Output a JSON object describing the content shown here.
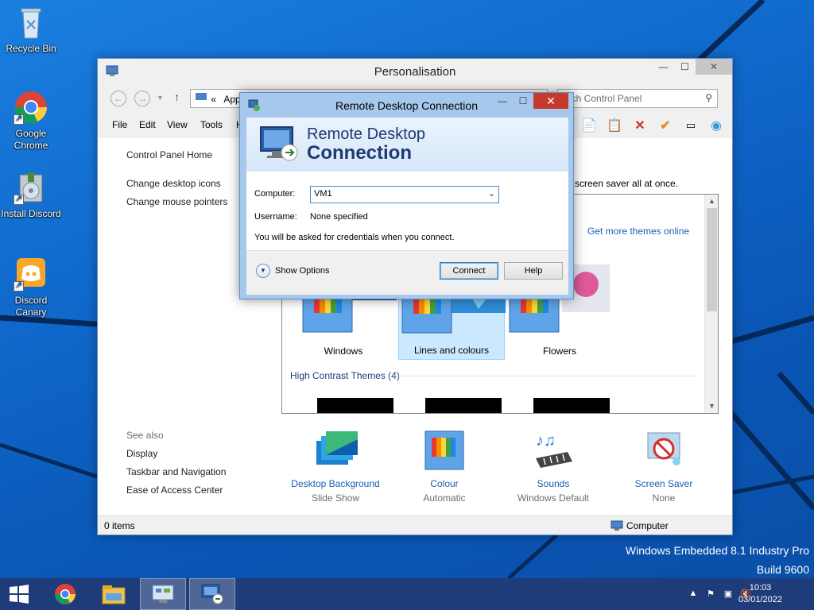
{
  "desktop": {
    "icons": [
      {
        "label": "Recycle Bin",
        "icon": "recycle-bin-icon"
      },
      {
        "label": "Google Chrome",
        "icon": "chrome-icon"
      },
      {
        "label": "Install Discord",
        "icon": "installer-icon"
      },
      {
        "label": "Discord Canary",
        "icon": "discord-icon"
      }
    ],
    "watermark_line1": "Windows Embedded 8.1 Industry Pro",
    "watermark_line2": "Build 9600"
  },
  "taskbar": {
    "start_icon": "windows-start-icon",
    "pinned": [
      {
        "icon": "chrome-icon"
      },
      {
        "icon": "file-explorer-icon"
      },
      {
        "icon": "control-panel-icon"
      },
      {
        "icon": "remote-desktop-icon"
      }
    ],
    "tray_icons": [
      "chevron-up-icon",
      "flag-icon",
      "network-icon",
      "speaker-muted-icon"
    ],
    "time": "10:03",
    "date": "03/01/2022"
  },
  "personalisation": {
    "title": "Personalisation",
    "address_chevron": "«",
    "address": "App",
    "search_placeholder": "Search Control Panel",
    "search_visible": "arch Control Panel",
    "menu": [
      "File",
      "Edit",
      "View",
      "Tools",
      "H"
    ],
    "left_nav": {
      "home": "Control Panel Home",
      "links": [
        "Change desktop icons",
        "Change mouse pointers"
      ]
    },
    "description_fragment": "screen saver all at once.",
    "get_more_themes": "Get more themes online",
    "themes": [
      {
        "label": "Windows",
        "selected": false
      },
      {
        "label": "Lines and colours",
        "selected": true
      },
      {
        "label": "Flowers",
        "selected": false
      }
    ],
    "high_contrast_heading": "High Contrast Themes (4)",
    "see_also": {
      "heading": "See also",
      "links": [
        "Display",
        "Taskbar and Navigation",
        "Ease of Access Center"
      ]
    },
    "bottom_items": [
      {
        "label": "Desktop Background",
        "sub": "Slide Show",
        "icon": "desktop-background-icon"
      },
      {
        "label": "Colour",
        "sub": "Automatic",
        "icon": "colour-icon"
      },
      {
        "label": "Sounds",
        "sub": "Windows Default",
        "icon": "sounds-icon"
      },
      {
        "label": "Screen Saver",
        "sub": "None",
        "icon": "screen-saver-icon"
      }
    ],
    "status_left": "0 items",
    "status_right": "Computer"
  },
  "rdc": {
    "title": "Remote Desktop Connection",
    "banner_line1": "Remote Desktop",
    "banner_line2": "Connection",
    "computer_label": "Computer:",
    "computer_value": "VM1",
    "username_label": "Username:",
    "username_value": "None specified",
    "credentials_note": "You will be asked for credentials when you connect.",
    "show_options": "Show Options",
    "connect": "Connect",
    "help": "Help"
  }
}
